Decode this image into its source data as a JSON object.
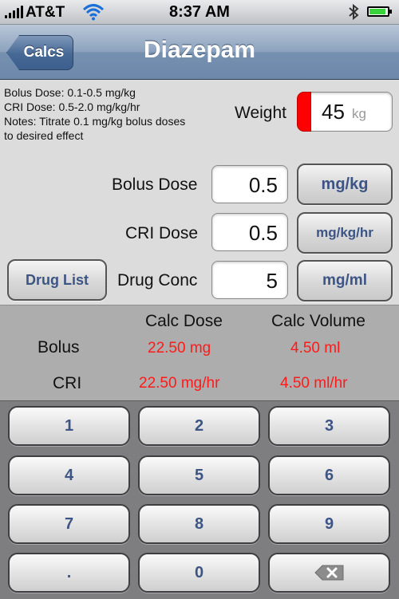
{
  "status": {
    "carrier": "AT&T",
    "time": "8:37 AM",
    "battery_level": 0.9
  },
  "nav": {
    "back_label": "Calcs",
    "title": "Diazepam"
  },
  "notes": {
    "bolus": "Bolus Dose: 0.1-0.5 mg/kg",
    "cri": "CRI Dose: 0.5-2.0 mg/kg/hr",
    "notes_line1": "Notes: Titrate 0.1 mg/kg bolus doses",
    "notes_line2": "to desired effect"
  },
  "weight": {
    "label": "Weight",
    "value": "45",
    "unit": "kg"
  },
  "bolus_dose": {
    "label": "Bolus Dose",
    "value": "0.5",
    "unit": "mg/kg"
  },
  "cri_dose": {
    "label": "CRI Dose",
    "value": "0.5",
    "unit": "mg/kg/hr"
  },
  "drug_conc": {
    "label": "Drug Conc",
    "value": "5",
    "unit": "mg/ml"
  },
  "drug_list_label": "Drug List",
  "results": {
    "header_dose": "Calc Dose",
    "header_volume": "Calc Volume",
    "bolus": {
      "label": "Bolus",
      "dose": "22.50 mg",
      "volume": "4.50 ml"
    },
    "cri": {
      "label": "CRI",
      "dose": "22.50 mg/hr",
      "volume": "4.50 ml/hr"
    }
  },
  "keypad": {
    "keys": [
      "1",
      "2",
      "3",
      "4",
      "5",
      "6",
      "7",
      "8",
      "9",
      ".",
      "0"
    ],
    "delete_icon": "backspace-icon"
  },
  "colors": {
    "result_red": "#ff1a1a",
    "weight_highlight": "#ff0000",
    "button_text_blue": "#3c5585",
    "nav_blue": "#6d88aa"
  }
}
